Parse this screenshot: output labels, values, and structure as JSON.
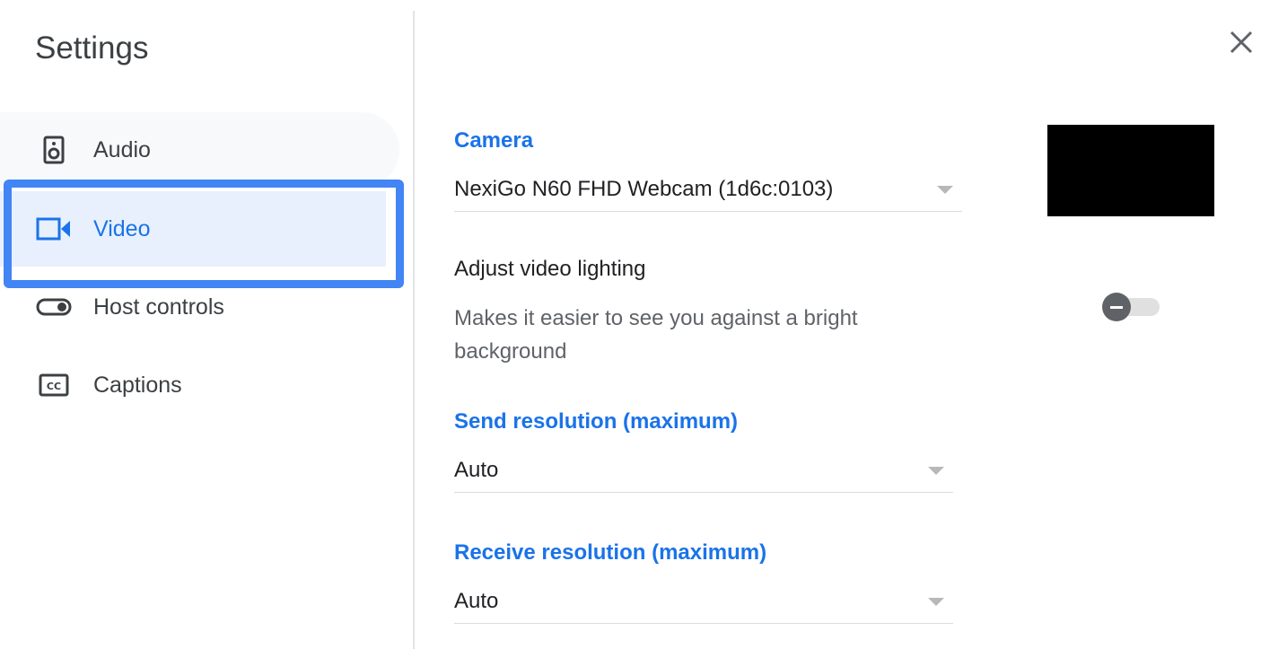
{
  "dialog": {
    "title": "Settings",
    "close_icon": "close-icon"
  },
  "sidebar": {
    "items": [
      {
        "label": "Audio",
        "icon": "speaker-icon",
        "selected": false
      },
      {
        "label": "Video",
        "icon": "video-camera-icon",
        "selected": true
      },
      {
        "label": "Host controls",
        "icon": "toggle-icon",
        "selected": false
      },
      {
        "label": "Captions",
        "icon": "closed-captions-icon",
        "selected": false
      }
    ]
  },
  "video": {
    "camera": {
      "label": "Camera",
      "value": "NexiGo N60 FHD Webcam (1d6c:0103)"
    },
    "lighting": {
      "title": "Adjust video lighting",
      "description": "Makes it easier to see you against a bright background",
      "enabled": false
    },
    "send_resolution": {
      "label": "Send resolution (maximum)",
      "value": "Auto"
    },
    "receive_resolution": {
      "label": "Receive resolution (maximum)",
      "value": "Auto"
    }
  },
  "colors": {
    "accent": "#1a73e8",
    "selected_bg": "#e8f0fe",
    "highlight_border": "#4285f4"
  }
}
